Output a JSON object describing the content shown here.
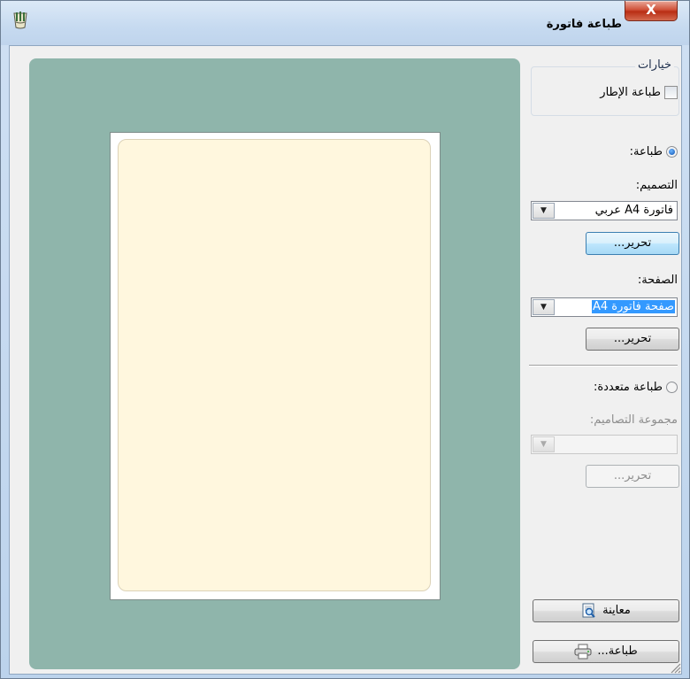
{
  "window": {
    "title": "طباعة فاتورة",
    "close_glyph": "X"
  },
  "options_group": {
    "legend": "خيارات",
    "print_frame_label": "طباعة الإطار"
  },
  "single_print": {
    "radio_label": "طباعة:",
    "design_label": "التصميم:",
    "design_value": "فاتورة A4 عربي",
    "design_edit_button": "تحرير...",
    "page_label": "الصفحة:",
    "page_value": "صفحة فاتورة A4",
    "page_edit_button": "تحرير..."
  },
  "multi_print": {
    "radio_label": "طباعة متعددة:",
    "designs_group_label": "مجموعة التصاميم:",
    "designs_group_value": "",
    "edit_button": "تحرير..."
  },
  "actions": {
    "preview_button": "معاينة",
    "print_button": "طباعة..."
  },
  "colors": {
    "preview_background": "#8fb5ab",
    "paper_fill": "#fff7de",
    "selection": "#3399ff"
  },
  "icons": [
    "app-icon",
    "close-icon",
    "dropdown-arrow-icon",
    "preview-icon",
    "printer-icon",
    "resize-grip-icon"
  ]
}
